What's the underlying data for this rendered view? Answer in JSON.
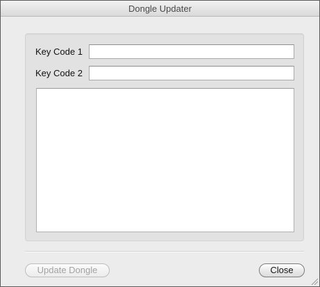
{
  "window": {
    "title": "Dongle Updater"
  },
  "form": {
    "key_code_1_label": "Key Code 1",
    "key_code_1_value": "",
    "key_code_2_label": "Key Code 2",
    "key_code_2_value": "",
    "output_text": ""
  },
  "buttons": {
    "update_label": "Update Dongle",
    "update_enabled": false,
    "close_label": "Close"
  },
  "icons": {
    "resize": "resize-grip-icon"
  }
}
